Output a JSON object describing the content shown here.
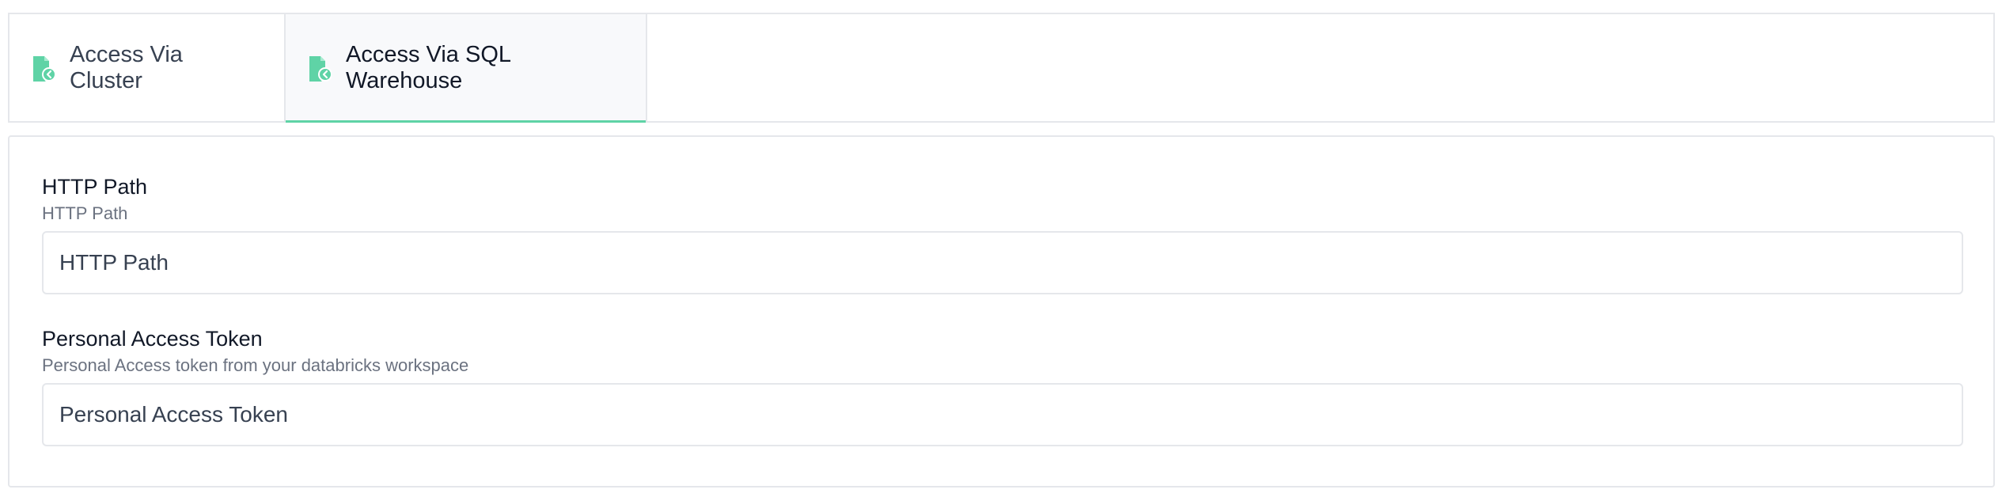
{
  "tabs": [
    {
      "label": "Access Via Cluster",
      "icon": "document-arrow-icon",
      "active": false
    },
    {
      "label": "Access Via SQL Warehouse",
      "icon": "document-arrow-icon",
      "active": true
    }
  ],
  "form": {
    "http_path": {
      "label": "HTTP Path",
      "description": "HTTP Path",
      "placeholder": "HTTP Path",
      "value": ""
    },
    "token": {
      "label": "Personal Access Token",
      "description": "Personal Access token from your databricks workspace",
      "placeholder": "Personal Access Token",
      "value": ""
    }
  },
  "colors": {
    "accent": "#5fd3a6",
    "icon": "#5fd3a6",
    "border": "#e5e7eb",
    "muted_text": "#6b7280"
  }
}
